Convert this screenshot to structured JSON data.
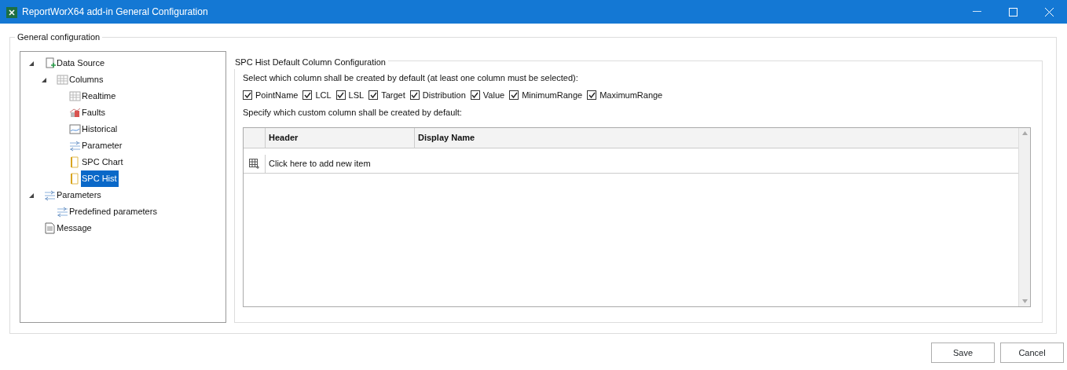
{
  "window": {
    "title": "ReportWorX64 add-in General Configuration"
  },
  "group_title": "General configuration",
  "tree": [
    {
      "label": "Data Source",
      "kind": "datasource",
      "expanded": true,
      "selected": false,
      "children": [
        {
          "label": "Columns",
          "kind": "grid",
          "expanded": true,
          "selected": false,
          "children": [
            {
              "label": "Realtime",
              "kind": "grid",
              "selected": false
            },
            {
              "label": "Faults",
              "kind": "faults",
              "selected": false
            },
            {
              "label": "Historical",
              "kind": "historical",
              "selected": false
            },
            {
              "label": "Parameter",
              "kind": "parameter",
              "selected": false
            },
            {
              "label": "SPC Chart",
              "kind": "doc",
              "selected": false
            },
            {
              "label": "SPC Hist",
              "kind": "doc",
              "selected": true
            }
          ]
        }
      ]
    },
    {
      "label": "Parameters",
      "kind": "parameter",
      "expanded": true,
      "selected": false,
      "children": [
        {
          "label": "Predefined parameters",
          "kind": "parameter",
          "selected": false
        }
      ]
    },
    {
      "label": "Message",
      "kind": "message",
      "selected": false
    }
  ],
  "panel": {
    "title": "SPC Hist Default Column Configuration",
    "select_prompt": "Select which column shall be created by default (at least one column must be selected):",
    "columns": [
      {
        "label": "PointName",
        "checked": true
      },
      {
        "label": "LCL",
        "checked": true
      },
      {
        "label": "LSL",
        "checked": true
      },
      {
        "label": "Target",
        "checked": true
      },
      {
        "label": "Distribution",
        "checked": true
      },
      {
        "label": "Value",
        "checked": true
      },
      {
        "label": "MinimumRange",
        "checked": true
      },
      {
        "label": "MaximumRange",
        "checked": true
      }
    ],
    "custom_prompt": "Specify which custom column shall be created by default:",
    "table": {
      "columns": [
        "Header",
        "Display Name"
      ],
      "new_item": "Click here to add new item"
    }
  },
  "buttons": [
    "Save",
    "Cancel"
  ]
}
